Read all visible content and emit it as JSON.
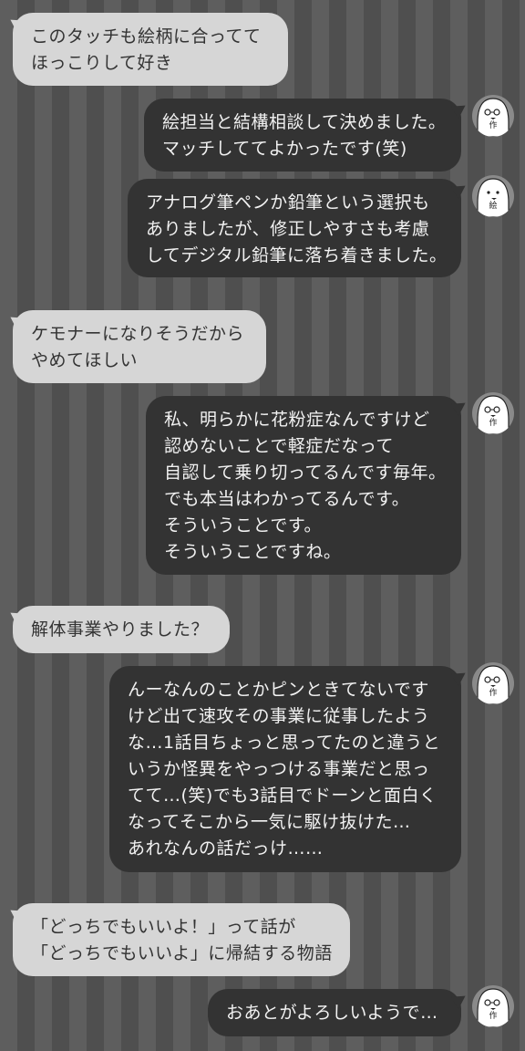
{
  "messages": [
    {
      "side": "left",
      "lines": [
        "このタッチも絵柄に合ってて",
        "ほっこりして好き"
      ]
    },
    {
      "side": "right",
      "avatar": "作",
      "lines": [
        "絵担当と結構相談して決めました。",
        "マッチしててよかったです(笑)"
      ]
    },
    {
      "side": "right",
      "avatar": "絵",
      "lines": [
        "アナログ筆ペンか鉛筆という選択も",
        "ありましたが、修正しやすさも考慮",
        "してデジタル鉛筆に落ち着きました。"
      ]
    },
    {
      "side": "left",
      "lines": [
        "ケモナーになりそうだから",
        "やめてほしい"
      ]
    },
    {
      "side": "right",
      "avatar": "作",
      "lines": [
        "私、明らかに花粉症なんですけど",
        "認めないことで軽症だなって",
        "自認して乗り切ってるんです毎年。",
        "でも本当はわかってるんです。",
        "そういうことです。",
        "そういうことですね。"
      ]
    },
    {
      "side": "left",
      "lines": [
        "解体事業やりました？"
      ]
    },
    {
      "side": "right",
      "avatar": "作",
      "lines": [
        "んーなんのことかピンときてないです",
        "けど出て速攻その事業に従事したよう",
        "な…1話目ちょっと思ってたのと違うと",
        "いうか怪異をやっつける事業だと思っ",
        "てて…(笑)でも3話目でドーンと面白く",
        "なってそこから一気に駆け抜けた…",
        "あれなんの話だっけ……"
      ]
    },
    {
      "side": "left",
      "lines": [
        "「どっちでもいいよ！」って話が",
        "「どっちでもいいよ」に帰結する物語"
      ]
    },
    {
      "side": "right",
      "avatar": "作",
      "lines": [
        "おあとがよろしいようで…"
      ]
    }
  ]
}
